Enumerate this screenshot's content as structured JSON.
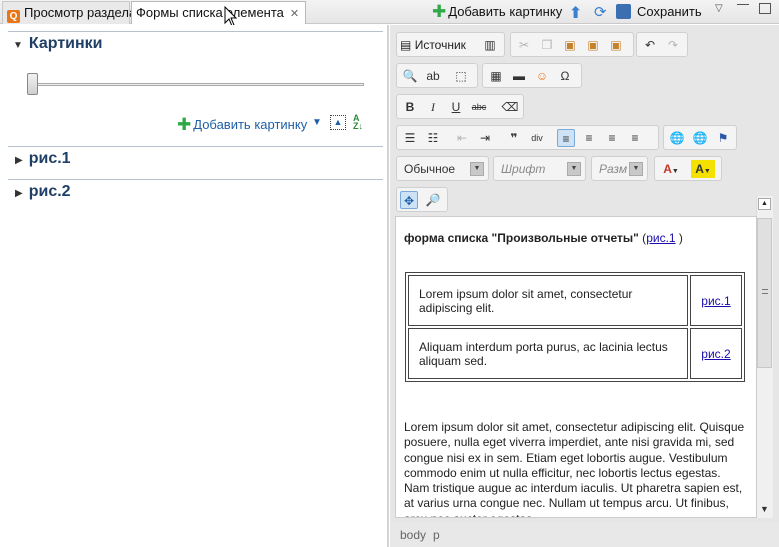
{
  "tabs": [
    {
      "label": "Просмотр раздела"
    },
    {
      "label": "Формы списка элемента"
    }
  ],
  "toolbar": {
    "add_picture": "Добавить картинку",
    "save": "Сохранить"
  },
  "left": {
    "section_title": "Картинки",
    "add_picture_link": "Добавить картинку",
    "items": [
      {
        "label": "рис.1"
      },
      {
        "label": "рис.2"
      }
    ]
  },
  "editor_toolbar": {
    "source_label": "Источник",
    "format_combo": "Обычное",
    "font_combo": "Шрифт",
    "size_combo": "Разм"
  },
  "document": {
    "heading": "форма списка \"Произвольные отчеты\"",
    "heading_link": "рис.1",
    "rows": [
      {
        "text": "Lorem ipsum dolor sit amet, consectetur adipiscing elit.",
        "link": "рис.1"
      },
      {
        "text": "Aliquam interdum porta purus, ac lacinia lectus aliquam sed.",
        "link": "рис.2"
      }
    ],
    "paragraph": "Lorem ipsum dolor sit amet, consectetur adipiscing elit. Quisque posuere, nulla eget viverra imperdiet, ante nisi gravida mi, sed congue nisi ex in sem. Etiam eget lobortis augue. Vestibulum commodo enim ut nulla efficitur, nec lobortis lectus egestas. Nam tristique augue ac interdum iaculis. Ut pharetra sapien est, at varius urna congue nec. Nullam ut tempus arcu. Ut finibus, arcu nec auctor egestas"
  },
  "status": {
    "path1": "body",
    "path2": "p"
  }
}
